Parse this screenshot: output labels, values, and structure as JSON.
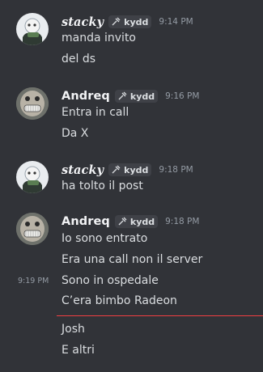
{
  "messages": [
    {
      "author": "stacky",
      "tag": "kydd",
      "time": "9:14 PM",
      "lines": [
        "manda invito",
        "del ds"
      ]
    },
    {
      "author": "Andreq",
      "tag": "kydd",
      "time": "9:16 PM",
      "lines": [
        "Entra in call",
        "Da X"
      ]
    },
    {
      "author": "stacky",
      "tag": "kydd",
      "time": "9:18 PM",
      "lines": [
        "ha tolto il post"
      ]
    },
    {
      "author": "Andreq",
      "tag": "kydd",
      "time": "9:18 PM",
      "lines": [
        "Io sono entrato",
        "Era una call non il server",
        "Sono in ospedale",
        "C’era bimbo Radeon"
      ],
      "hover_time": "9:19 PM"
    }
  ],
  "after_divider": {
    "lines": [
      "Josh",
      "E altri"
    ]
  },
  "colors": {
    "background": "#313338",
    "text": "#dbdee1",
    "username": "#f2f3f5",
    "muted": "#949ba4",
    "tag_bg": "#3f4147",
    "divider": "#f23f42"
  },
  "icons": {
    "tag": "tag-icon"
  }
}
